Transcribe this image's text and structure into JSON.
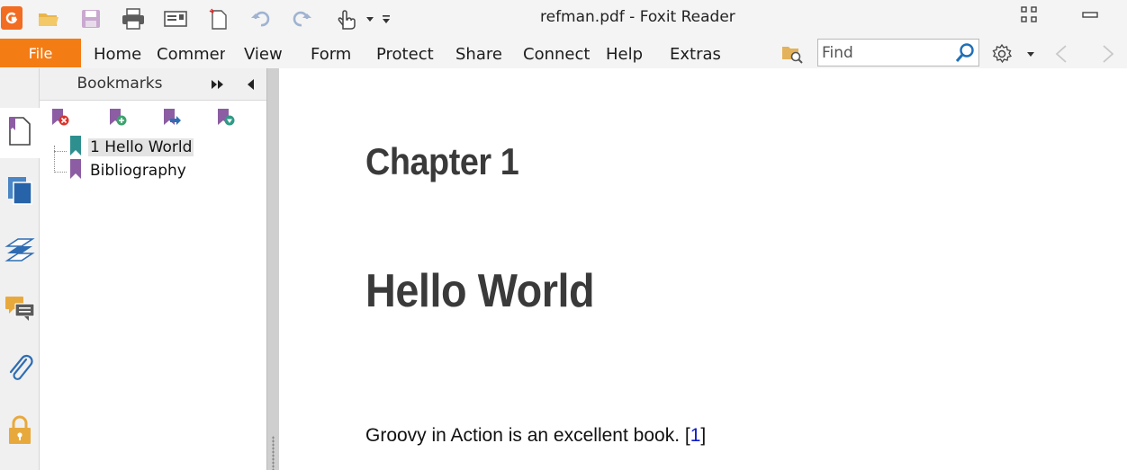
{
  "window": {
    "title": "refman.pdf - Foxit Reader"
  },
  "menu": {
    "file": "File",
    "tabs": [
      "Home",
      "Comment",
      "View",
      "Form",
      "Protect",
      "Share",
      "Connect",
      "Help",
      "Extras"
    ]
  },
  "search": {
    "placeholder": "Find"
  },
  "bookmarks": {
    "title": "Bookmarks",
    "items": [
      "1 Hello World",
      "Bibliography"
    ]
  },
  "document": {
    "chapter_label": "Chapter 1",
    "chapter_title": "Hello World",
    "body_text": "Groovy in Action is an excellent book. ",
    "citation_open": "[",
    "citation_number": "1",
    "citation_close": "]"
  },
  "colors": {
    "accent": "#f47c14",
    "bookmark_teal": "#2e8f8f",
    "bookmark_purple": "#8c5da3",
    "link": "#0b19c8"
  },
  "icons": {
    "quick_access": [
      "app-logo-icon",
      "open-folder-icon",
      "save-icon",
      "print-icon",
      "email-icon",
      "new-document-icon",
      "undo-icon",
      "redo-icon",
      "hand-tool-icon",
      "customize-toolbar-icon"
    ],
    "left_rail": [
      "pages-panel-icon",
      "thumbnails-icon",
      "layers-icon",
      "comments-icon",
      "attachments-icon",
      "security-icon"
    ],
    "bookmark_tools": [
      "delete-bookmark-icon",
      "add-bookmark-icon",
      "go-to-bookmark-icon",
      "bookmark-options-icon"
    ]
  }
}
